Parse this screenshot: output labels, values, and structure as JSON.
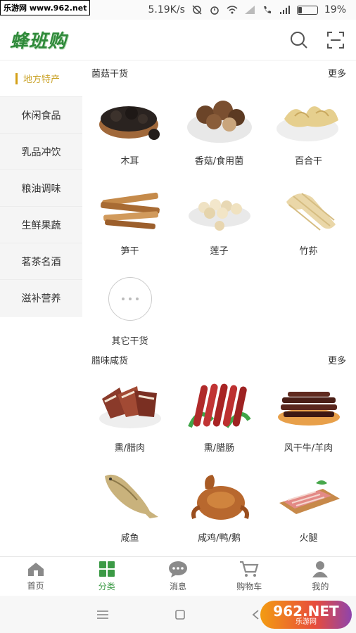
{
  "watermark_top": "乐游网 www.962.net",
  "status_bar": {
    "speed": "5.19K/s",
    "battery": "19%",
    "battery_level": 0.19
  },
  "header": {
    "logo": "蜂班购"
  },
  "sidebar": {
    "items": [
      {
        "label": "地方特产",
        "active": true
      },
      {
        "label": "休闲食品"
      },
      {
        "label": "乳品冲饮"
      },
      {
        "label": "粮油调味"
      },
      {
        "label": "生鲜果蔬"
      },
      {
        "label": "茗茶名酒"
      },
      {
        "label": "滋补营养"
      }
    ]
  },
  "sections": [
    {
      "title": "菌菇干货",
      "more": "更多",
      "items": [
        {
          "label": "木耳"
        },
        {
          "label": "香菇/食用菌"
        },
        {
          "label": "百合干"
        },
        {
          "label": "笋干"
        },
        {
          "label": "莲子"
        },
        {
          "label": "竹荪"
        },
        {
          "label": "其它干货"
        }
      ]
    },
    {
      "title": "腊味咸货",
      "more": "更多",
      "items": [
        {
          "label": "熏/腊肉"
        },
        {
          "label": "熏/腊肠"
        },
        {
          "label": "风干牛/羊肉"
        },
        {
          "label": "咸鱼"
        },
        {
          "label": "咸鸡/鸭/鹅"
        },
        {
          "label": "火腿"
        }
      ]
    }
  ],
  "tabbar": {
    "items": [
      {
        "label": "首页",
        "icon": "home-icon"
      },
      {
        "label": "分类",
        "icon": "category-icon",
        "active": true
      },
      {
        "label": "消息",
        "icon": "message-icon"
      },
      {
        "label": "购物车",
        "icon": "cart-icon"
      },
      {
        "label": "我的",
        "icon": "profile-icon"
      }
    ]
  },
  "watermark_br": {
    "big": "962.NET",
    "small": "乐游网"
  },
  "colors": {
    "accent_green": "#3b9a45",
    "active_gold": "#d4a017"
  }
}
